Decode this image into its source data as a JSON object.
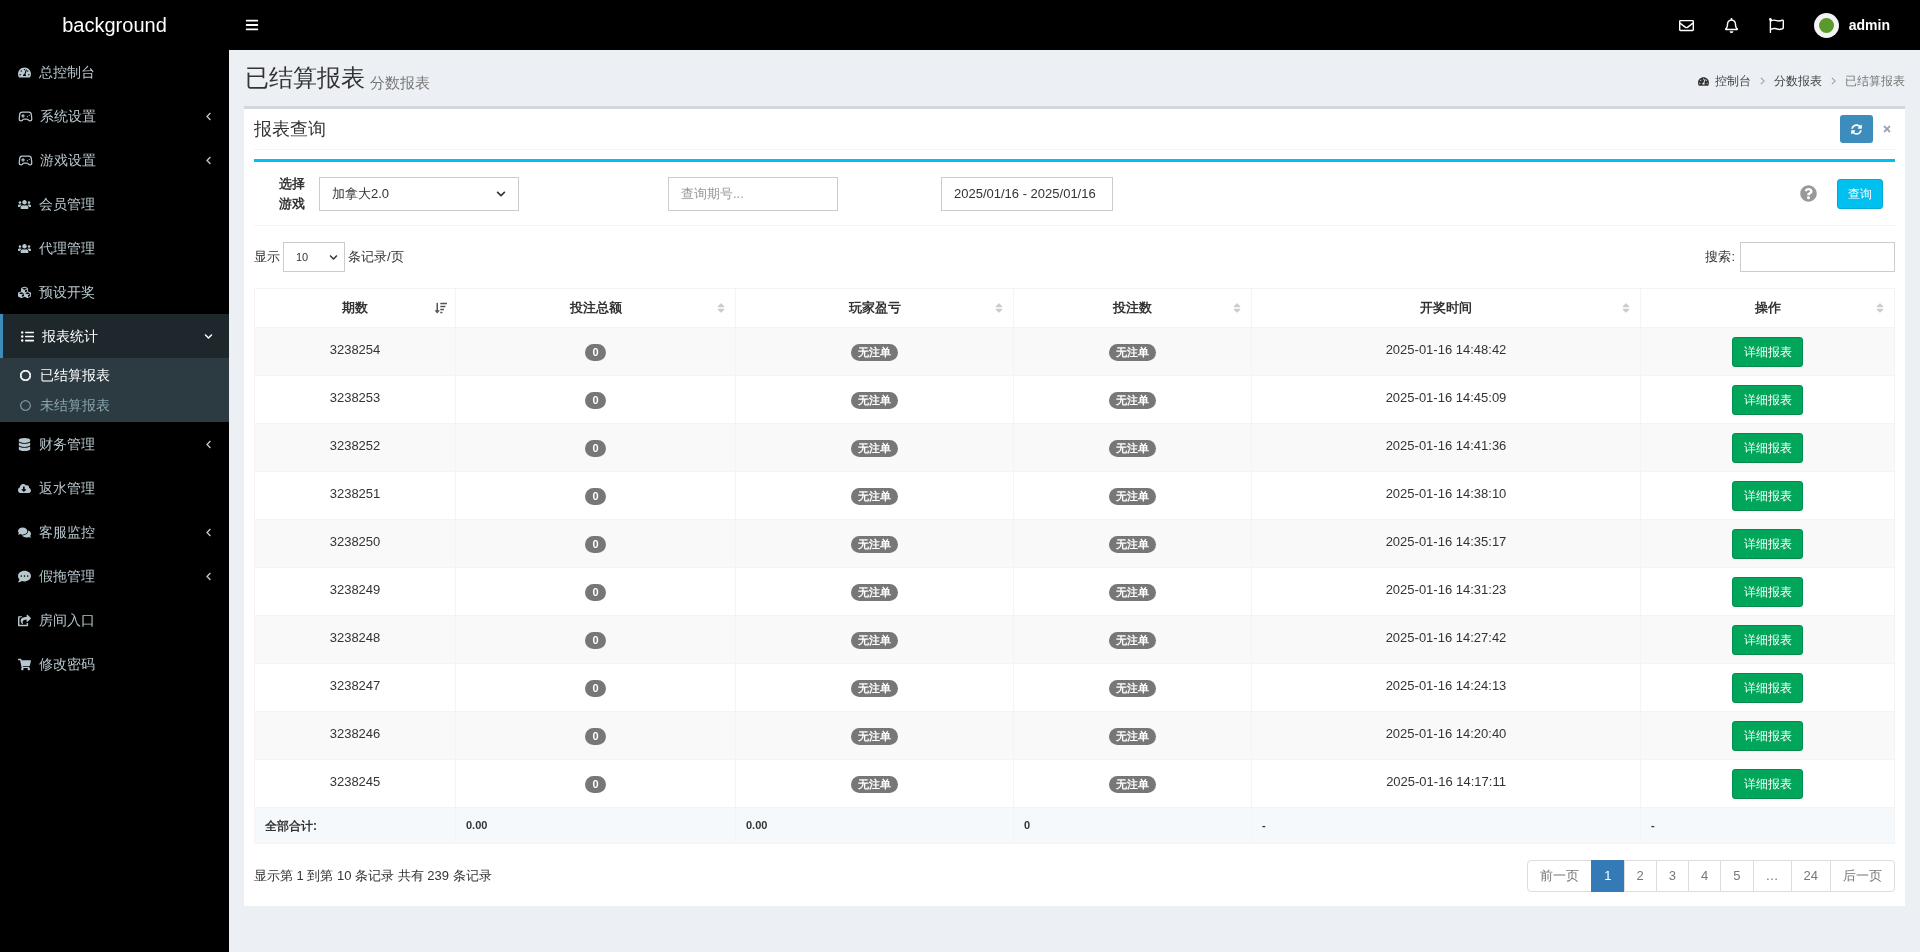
{
  "brand": "background",
  "user": {
    "name": "admin"
  },
  "sidebar": {
    "items": [
      {
        "label": "总控制台",
        "expandable": false,
        "selected": false
      },
      {
        "label": "系统设置",
        "expandable": true,
        "expanded": false,
        "selected": false
      },
      {
        "label": "游戏设置",
        "expandable": true,
        "expanded": false,
        "selected": false
      },
      {
        "label": "会员管理",
        "expandable": false,
        "selected": false
      },
      {
        "label": "代理管理",
        "expandable": false,
        "selected": false
      },
      {
        "label": "预设开奖",
        "expandable": false,
        "selected": false
      },
      {
        "label": "报表统计",
        "expandable": true,
        "expanded": true,
        "selected": true,
        "children": [
          {
            "label": "已结算报表",
            "selected": true
          },
          {
            "label": "未结算报表",
            "selected": false
          }
        ]
      },
      {
        "label": "财务管理",
        "expandable": true,
        "expanded": false,
        "selected": false
      },
      {
        "label": "返水管理",
        "expandable": false,
        "selected": false
      },
      {
        "label": "客服监控",
        "expandable": true,
        "expanded": false,
        "selected": false
      },
      {
        "label": "假拖管理",
        "expandable": true,
        "expanded": false,
        "selected": false
      },
      {
        "label": "房间入口",
        "expandable": false,
        "selected": false
      },
      {
        "label": "修改密码",
        "expandable": false,
        "selected": false
      }
    ]
  },
  "page": {
    "title": "已结算报表",
    "subtitle": "分数报表",
    "breadcrumb": [
      "控制台",
      "分数报表",
      "已结算报表"
    ]
  },
  "panel": {
    "title": "报表查询",
    "filters": {
      "game_label": "选择游戏",
      "game_value": "加拿大2.0",
      "period_placeholder": "查询期号...",
      "date_range": "2025/01/16 - 2025/01/16",
      "query_button": "查询"
    },
    "length": {
      "prefix": "显示",
      "value": "10",
      "suffix": "条记录/页"
    },
    "search": {
      "label": "搜索:"
    },
    "table": {
      "columns": [
        {
          "label": "期数",
          "sorted": true
        },
        {
          "label": "投注总额",
          "sorted": false
        },
        {
          "label": "玩家盈亏",
          "sorted": false
        },
        {
          "label": "投注数",
          "sorted": false
        },
        {
          "label": "开奖时间",
          "sorted": false
        },
        {
          "label": "操作",
          "sorted": false
        }
      ],
      "rows": [
        {
          "period": "3238254",
          "total": "0",
          "profit": "无注单",
          "count": "无注单",
          "time": "2025-01-16 14:48:42",
          "action": "详细报表"
        },
        {
          "period": "3238253",
          "total": "0",
          "profit": "无注单",
          "count": "无注单",
          "time": "2025-01-16 14:45:09",
          "action": "详细报表"
        },
        {
          "period": "3238252",
          "total": "0",
          "profit": "无注单",
          "count": "无注单",
          "time": "2025-01-16 14:41:36",
          "action": "详细报表"
        },
        {
          "period": "3238251",
          "total": "0",
          "profit": "无注单",
          "count": "无注单",
          "time": "2025-01-16 14:38:10",
          "action": "详细报表"
        },
        {
          "period": "3238250",
          "total": "0",
          "profit": "无注单",
          "count": "无注单",
          "time": "2025-01-16 14:35:17",
          "action": "详细报表"
        },
        {
          "period": "3238249",
          "total": "0",
          "profit": "无注单",
          "count": "无注单",
          "time": "2025-01-16 14:31:23",
          "action": "详细报表"
        },
        {
          "period": "3238248",
          "total": "0",
          "profit": "无注单",
          "count": "无注单",
          "time": "2025-01-16 14:27:42",
          "action": "详细报表"
        },
        {
          "period": "3238247",
          "total": "0",
          "profit": "无注单",
          "count": "无注单",
          "time": "2025-01-16 14:24:13",
          "action": "详细报表"
        },
        {
          "period": "3238246",
          "total": "0",
          "profit": "无注单",
          "count": "无注单",
          "time": "2025-01-16 14:20:40",
          "action": "详细报表"
        },
        {
          "period": "3238245",
          "total": "0",
          "profit": "无注单",
          "count": "无注单",
          "time": "2025-01-16 14:17:11",
          "action": "详细报表"
        }
      ],
      "footer": [
        "全部合计:",
        "0.00",
        "0.00",
        "0",
        "-",
        "-"
      ]
    },
    "info": "显示第 1 到第 10 条记录 共有 239 条记录",
    "pagination": [
      {
        "label": "前一页",
        "selected": false
      },
      {
        "label": "1",
        "selected": true
      },
      {
        "label": "2",
        "selected": false
      },
      {
        "label": "3",
        "selected": false
      },
      {
        "label": "4",
        "selected": false
      },
      {
        "label": "5",
        "selected": false
      },
      {
        "label": "…",
        "selected": false
      },
      {
        "label": "24",
        "selected": false
      },
      {
        "label": "后一页",
        "selected": false
      }
    ]
  }
}
